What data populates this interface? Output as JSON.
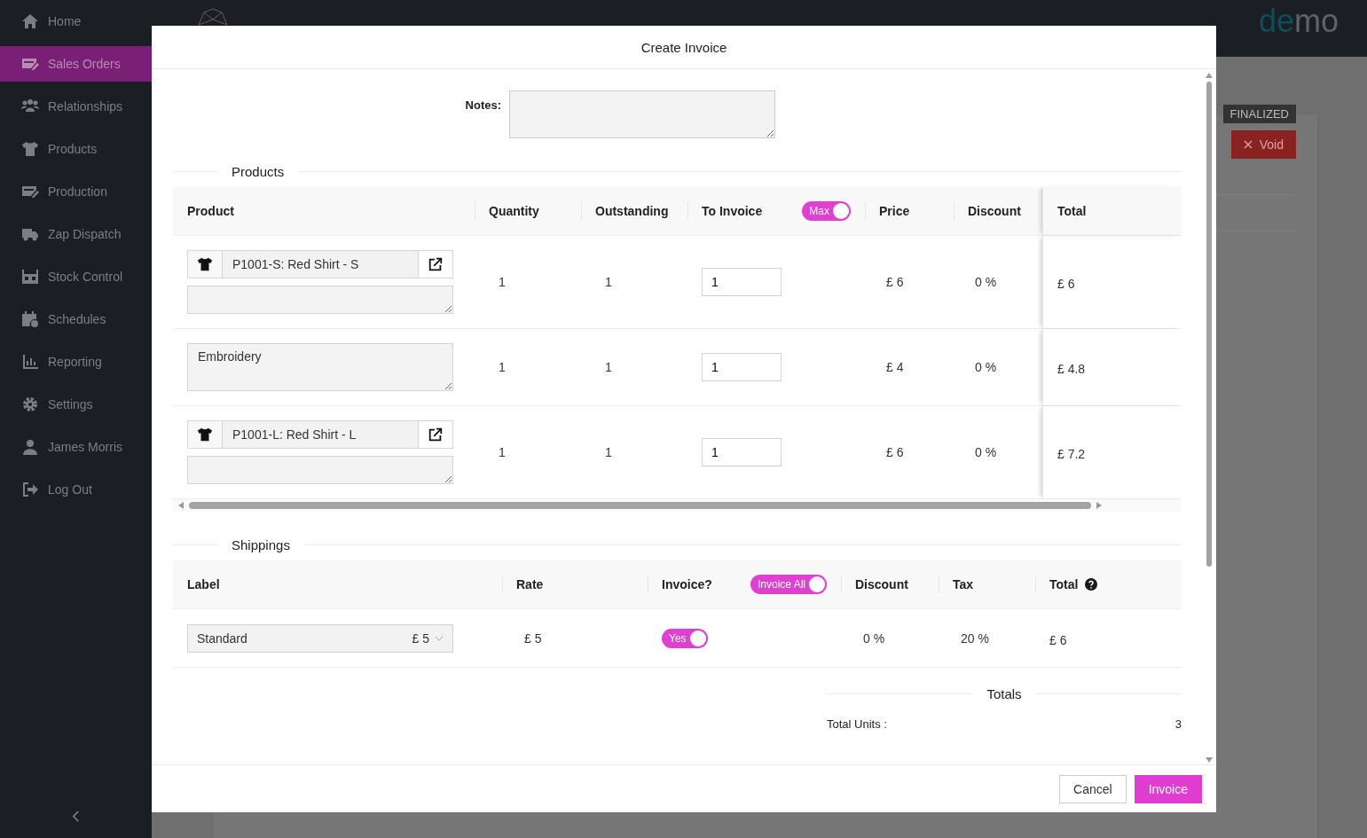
{
  "sidebar": {
    "items": [
      {
        "label": "Home",
        "selected": false
      },
      {
        "label": "Sales Orders",
        "selected": true
      },
      {
        "label": "Relationships",
        "selected": false
      },
      {
        "label": "Products",
        "selected": false
      },
      {
        "label": "Production",
        "selected": false
      },
      {
        "label": "Zap Dispatch",
        "selected": false
      },
      {
        "label": "Stock Control",
        "selected": false
      },
      {
        "label": "Schedules",
        "selected": false
      },
      {
        "label": "Reporting",
        "selected": false
      },
      {
        "label": "Settings",
        "selected": false
      },
      {
        "label": "James Morris",
        "selected": false
      },
      {
        "label": "Log Out",
        "selected": false
      }
    ]
  },
  "topbar": {
    "brand": "demo"
  },
  "order": {
    "status_badge": "FINALIZED",
    "void_button": "Void"
  },
  "dialog": {
    "title": "Create Invoice",
    "notes": {
      "label": "Notes:"
    },
    "products": {
      "legend": "Products",
      "columns": [
        {
          "label": "Product"
        },
        {
          "label": "Quantity"
        },
        {
          "label": "Outstanding"
        },
        {
          "label": "To Invoice",
          "toggle": {
            "label": "Max",
            "on": true
          }
        },
        {
          "label": "Price"
        },
        {
          "label": "Discount"
        },
        {
          "label": "Total"
        }
      ],
      "rows": [
        {
          "kind": "product",
          "name": "P1001-S: Red Shirt - S",
          "quantity": "1",
          "outstanding": "1",
          "to_invoice": "1",
          "price": "£ 6",
          "discount": "0 %",
          "total": "£ 6"
        },
        {
          "kind": "text",
          "description": "Embroidery",
          "quantity": "1",
          "outstanding": "1",
          "to_invoice": "1",
          "price": "£ 4",
          "discount": "0 %",
          "total": "£ 4.8"
        },
        {
          "kind": "product",
          "name": "P1001-L: Red Shirt - L",
          "quantity": "1",
          "outstanding": "1",
          "to_invoice": "1",
          "price": "£ 6",
          "discount": "0 %",
          "total": "£ 7.2"
        }
      ]
    },
    "shippings": {
      "legend": "Shippings",
      "columns": [
        {
          "label": "Label"
        },
        {
          "label": "Rate"
        },
        {
          "label": "Invoice?",
          "toggle": {
            "label": "Invoice All",
            "on": true
          }
        },
        {
          "label": "Discount"
        },
        {
          "label": "Tax"
        },
        {
          "label": "Total"
        }
      ],
      "rows": [
        {
          "label": "Standard",
          "label_rate": "£ 5",
          "rate": "£ 5",
          "invoice": {
            "label": "Yes",
            "on": true
          },
          "discount": "0 %",
          "tax": "20 %",
          "total": "£ 6"
        }
      ]
    },
    "totals": {
      "legend": "Totals",
      "rows": [
        {
          "label": "Total Units :",
          "value": "3"
        }
      ]
    },
    "buttons": [
      {
        "label": "Cancel",
        "kind": "secondary"
      },
      {
        "label": "Invoice",
        "kind": "primary"
      }
    ]
  }
}
